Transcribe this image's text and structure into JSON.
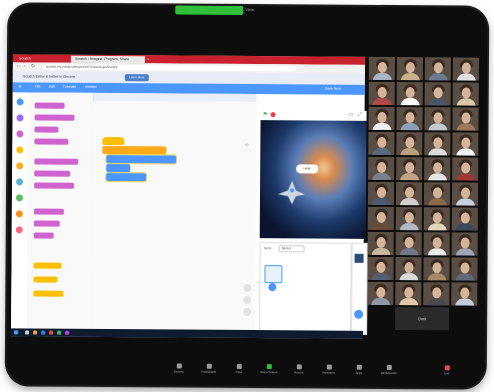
{
  "meeting": {
    "top_pill_label": "",
    "view_label": "View"
  },
  "browser": {
    "tabs": [
      {
        "label": "Scratch"
      },
      {
        "label": "Scratch - Imagine, Program, Share"
      },
      {
        "label": ""
      }
    ],
    "url": "scratch.mit.edu/projects/editor/?tutorial=getStarted",
    "notice_text": "Scratch Editor is better in Chrome",
    "notice_button": "Learn More"
  },
  "scratch": {
    "menu": [
      "File",
      "Edit",
      "Tutorials",
      "Untitled"
    ],
    "menu_right": "Save Now",
    "tabs": [
      "Code",
      "Costumes",
      "Sounds"
    ],
    "category_colors": [
      "#4c97ff",
      "#9966ff",
      "#cf63cf",
      "#ffbf00",
      "#ffab19",
      "#5cb1d6",
      "#59c059",
      "#ff8c1a",
      "#ff6680"
    ],
    "sprite_label": "Sprite",
    "sprite_name": "Sprite1",
    "speech_text": "Hello!"
  },
  "gallery": {
    "named_tile": "Ümit"
  },
  "toolbar": {
    "items": [
      "Security",
      "Participants",
      "Chat",
      "Share Screen",
      "Record",
      "Reactions",
      "Apps",
      "Whiteboards",
      "End"
    ]
  }
}
